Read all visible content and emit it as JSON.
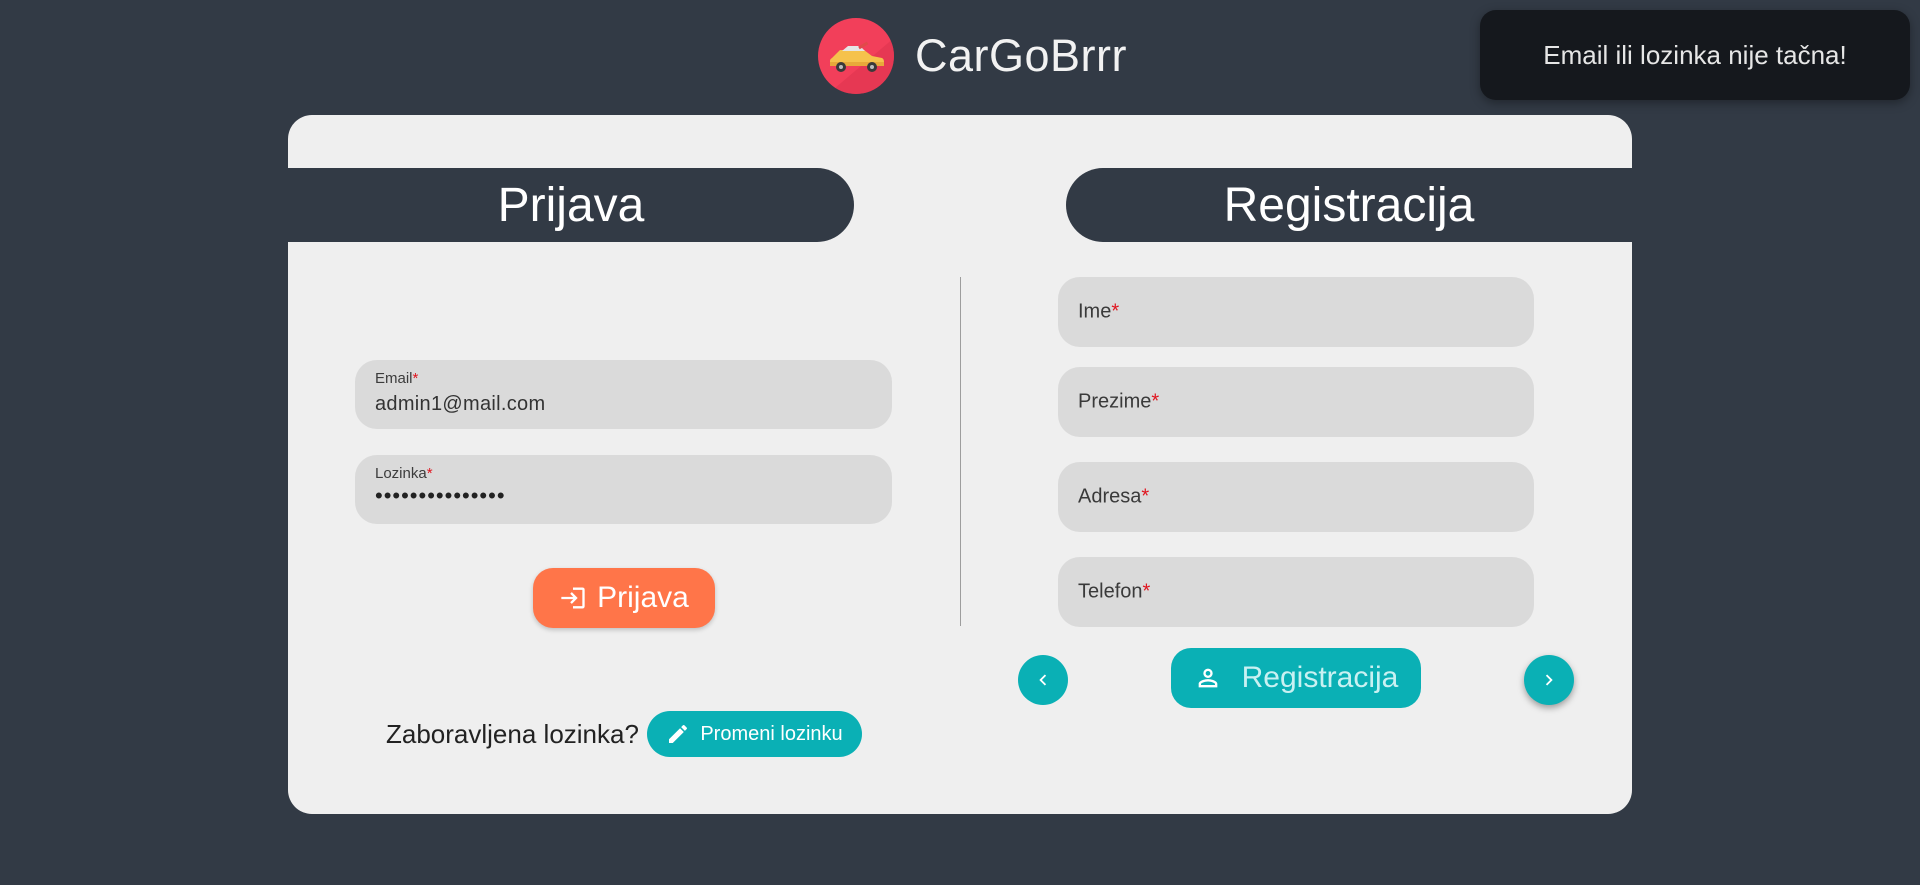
{
  "app": {
    "title": "CarGoBrrr",
    "logo_icon": "car-logo-icon"
  },
  "toast": {
    "message": "Email ili lozinka nije tačna!"
  },
  "login": {
    "heading": "Prijava",
    "email_label": "Email",
    "email_value": "admin1@mail.com",
    "password_label": "Lozinka",
    "password_value": "•••••••••••••••",
    "required_mark": "*",
    "submit_label": "Prijava",
    "submit_icon": "login-icon",
    "forgot_text": "Zaboravljena lozinka?",
    "change_password_label": "Promeni lozinku",
    "change_password_icon": "pencil-icon"
  },
  "register": {
    "heading": "Registracija",
    "fields": [
      {
        "placeholder": "Ime"
      },
      {
        "placeholder": "Prezime"
      },
      {
        "placeholder": "Adresa"
      },
      {
        "placeholder": "Telefon"
      }
    ],
    "required_mark": "*",
    "submit_label": "Registracija",
    "submit_icon": "person-icon",
    "prev_icon": "chevron-left-icon",
    "next_icon": "chevron-right-icon"
  },
  "colors": {
    "background": "#323a45",
    "card": "#efefef",
    "accent_orange": "#ff7549",
    "accent_teal": "#0ab0b5",
    "required": "#e0141e"
  }
}
